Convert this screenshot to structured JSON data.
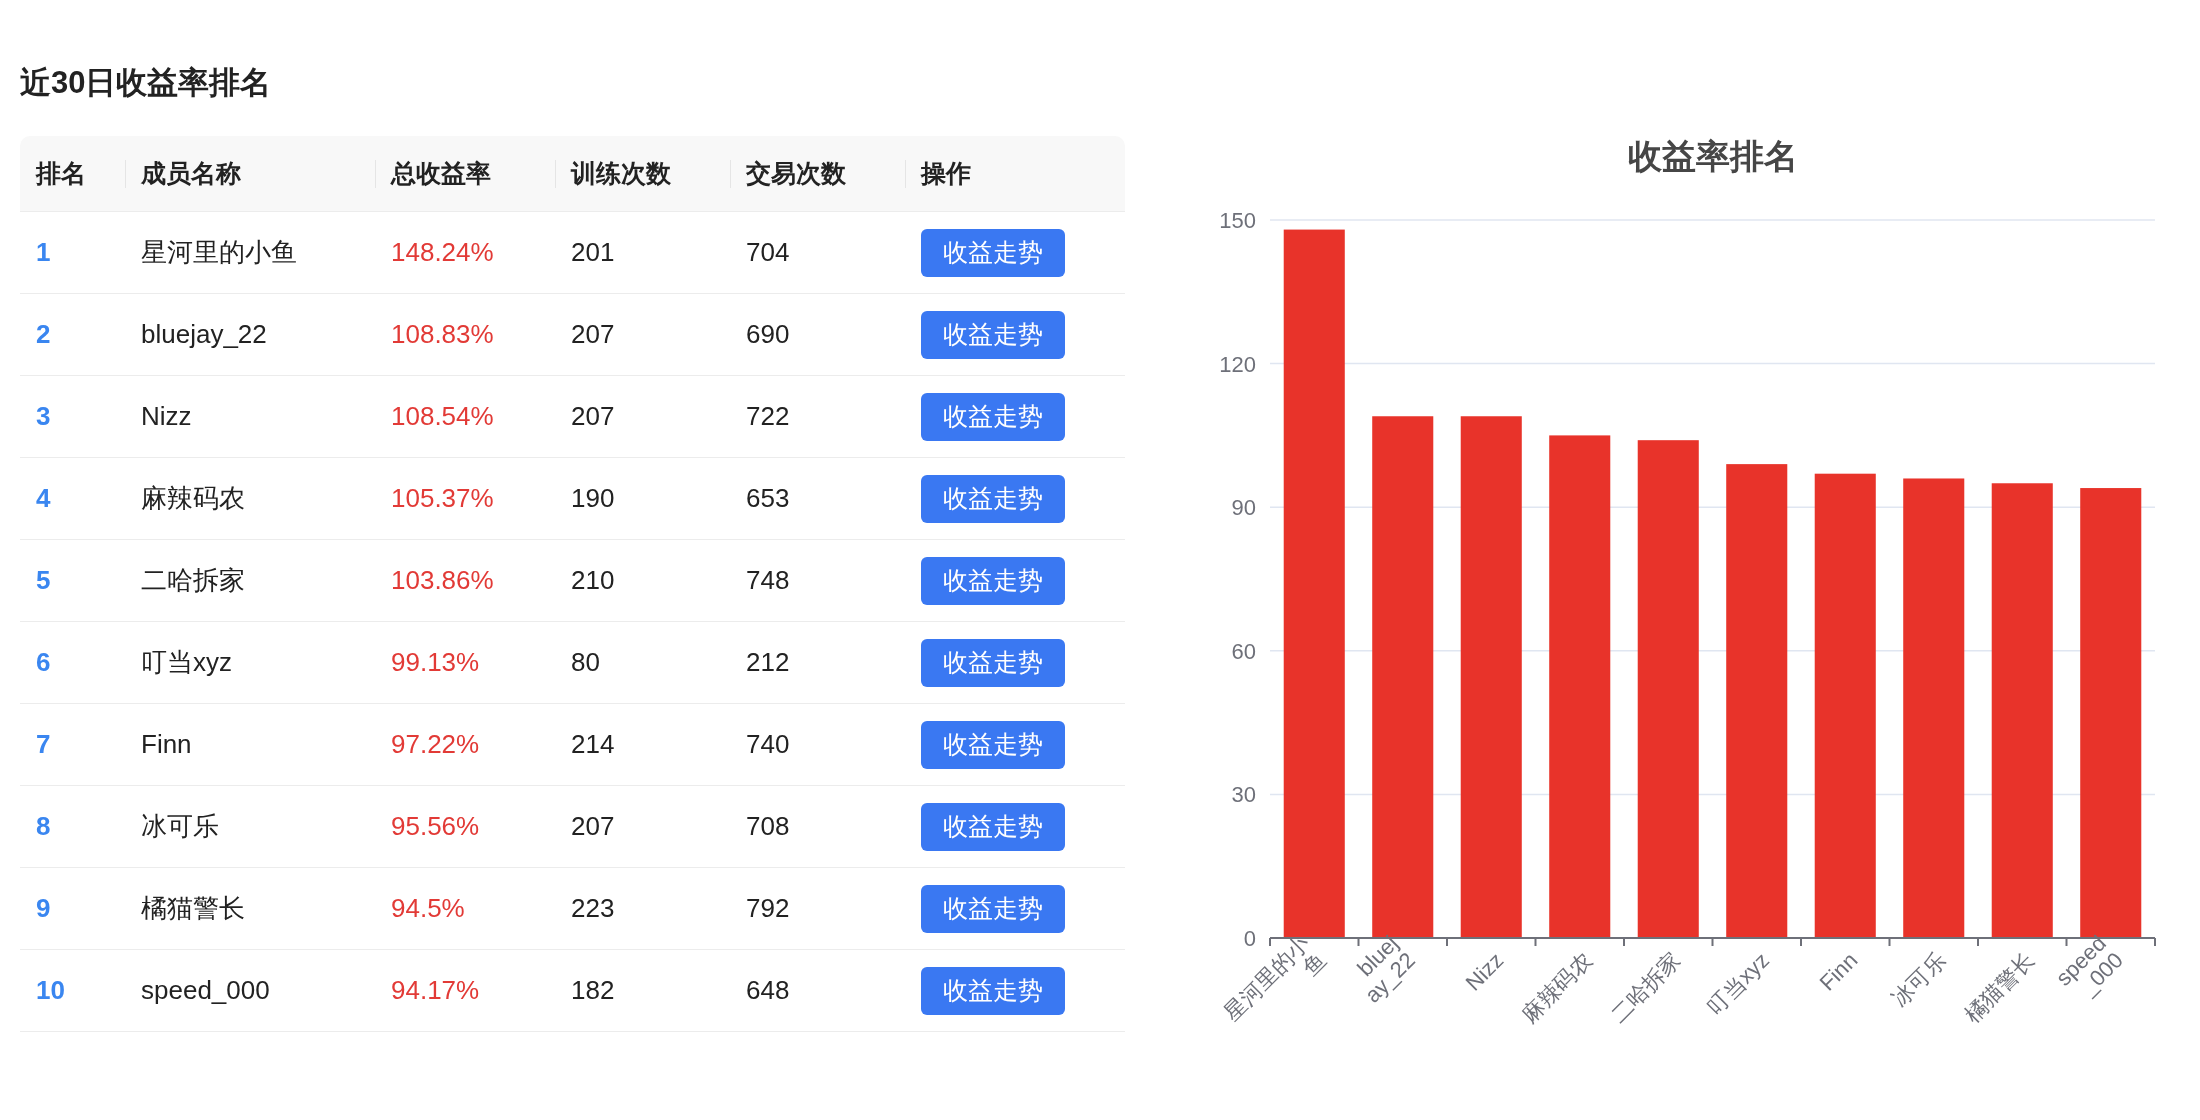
{
  "page_title": "近30日收益率排名",
  "table": {
    "columns": [
      "排名",
      "成员名称",
      "总收益率",
      "训练次数",
      "交易次数",
      "操作"
    ],
    "rows": [
      {
        "rank": "1",
        "name": "星河里的小鱼",
        "return": "148.24%",
        "trainings": "201",
        "trades": "704",
        "action": "收益走势"
      },
      {
        "rank": "2",
        "name": "bluejay_22",
        "return": "108.83%",
        "trainings": "207",
        "trades": "690",
        "action": "收益走势"
      },
      {
        "rank": "3",
        "name": "Nizz",
        "return": "108.54%",
        "trainings": "207",
        "trades": "722",
        "action": "收益走势"
      },
      {
        "rank": "4",
        "name": "麻辣码农",
        "return": "105.37%",
        "trainings": "190",
        "trades": "653",
        "action": "收益走势"
      },
      {
        "rank": "5",
        "name": "二哈拆家",
        "return": "103.86%",
        "trainings": "210",
        "trades": "748",
        "action": "收益走势"
      },
      {
        "rank": "6",
        "name": "叮当xyz",
        "return": "99.13%",
        "trainings": "80",
        "trades": "212",
        "action": "收益走势"
      },
      {
        "rank": "7",
        "name": "Finn",
        "return": "97.22%",
        "trainings": "214",
        "trades": "740",
        "action": "收益走势"
      },
      {
        "rank": "8",
        "name": "冰可乐",
        "return": "95.56%",
        "trainings": "207",
        "trades": "708",
        "action": "收益走势"
      },
      {
        "rank": "9",
        "name": "橘猫警长",
        "return": "94.5%",
        "trainings": "223",
        "trades": "792",
        "action": "收益走势"
      },
      {
        "rank": "10",
        "name": "speed_000",
        "return": "94.17%",
        "trainings": "182",
        "trades": "648",
        "action": "收益走势"
      }
    ]
  },
  "chart": {
    "chart_data": {
      "type": "bar",
      "title": "收益率排名",
      "categories": [
        "星河里的小鱼",
        "bluejay_22",
        "Nizz",
        "麻辣码农",
        "二哈拆家",
        "叮当xyz",
        "Finn",
        "冰可乐",
        "橘猫警长",
        "speed_000"
      ],
      "series": [
        {
          "color": "#e8332a",
          "values": [
            148,
            109,
            109,
            105,
            104,
            99,
            97,
            96,
            95,
            94
          ]
        }
      ],
      "grid": true,
      "ylim": [
        0,
        150
      ],
      "yticks": [
        0,
        30,
        60,
        90,
        120,
        150
      ]
    }
  }
}
